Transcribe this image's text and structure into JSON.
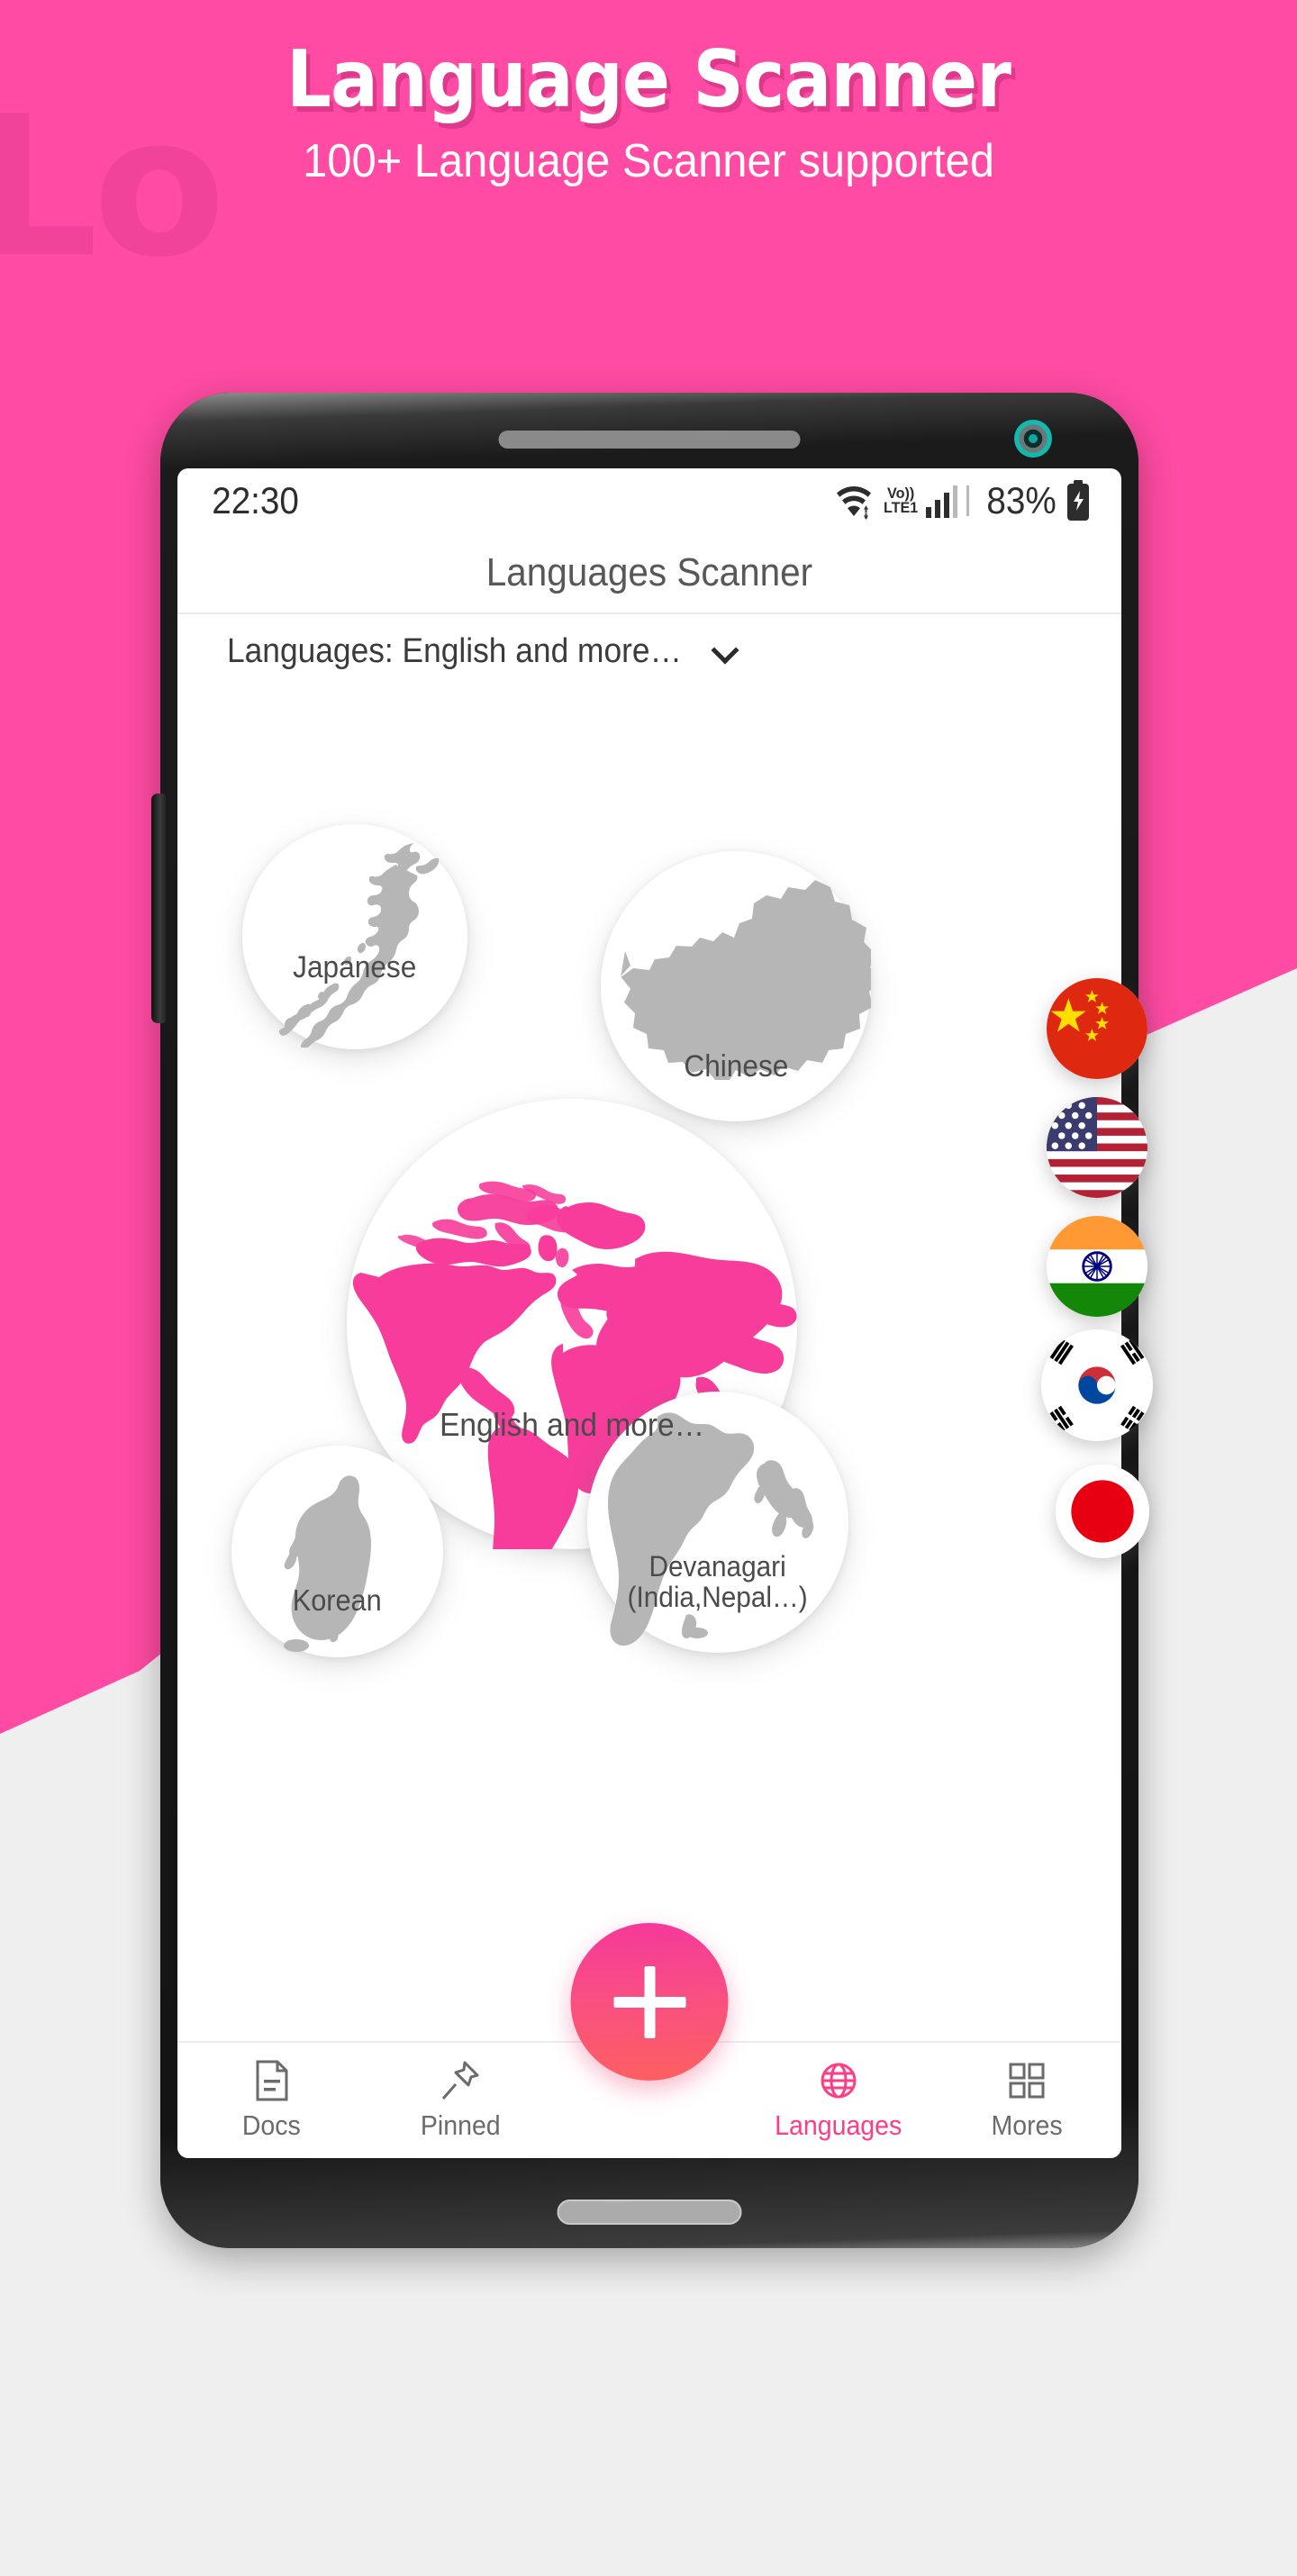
{
  "promo": {
    "headline": "Language Scanner",
    "subheadline": "100+ Language Scanner supported",
    "watermark": "Lo",
    "background_color": "#FF4BA3",
    "accent_color": "#FF3D86"
  },
  "status_bar": {
    "time": "22:30",
    "wifi_icon": "wifi-icon",
    "volte_top": "Vo))",
    "volte_bottom": "LTE1",
    "signal_icon": "signal-bars-icon",
    "battery_percent": "83%",
    "battery_icon": "battery-charging-icon"
  },
  "app_bar": {
    "title": "Languages Scanner"
  },
  "language_selector": {
    "label": "Languages: English and more…",
    "chevron_icon": "chevron-down-icon"
  },
  "bubbles": [
    {
      "id": "japanese",
      "label": "Japanese",
      "map_icon": "japan-map-icon"
    },
    {
      "id": "chinese",
      "label": "Chinese",
      "map_icon": "china-map-icon"
    },
    {
      "id": "english",
      "label": "English and more…",
      "map_icon": "world-map-icon"
    },
    {
      "id": "korean",
      "label": "Korean",
      "map_icon": "south-korea-map-icon"
    },
    {
      "id": "devanagari",
      "label": "Devanagari\n(India,Nepal…)",
      "label_line1": "Devanagari",
      "label_line2": "(India,Nepal…)",
      "map_icon": "india-map-icon"
    }
  ],
  "flags": [
    {
      "id": "cn",
      "name": "china-flag-icon"
    },
    {
      "id": "us",
      "name": "usa-flag-icon"
    },
    {
      "id": "in",
      "name": "india-flag-icon"
    },
    {
      "id": "kr",
      "name": "south-korea-flag-icon"
    },
    {
      "id": "jp",
      "name": "japan-flag-icon"
    }
  ],
  "fab": {
    "icon": "plus-icon",
    "gradient_from": "#F5389B",
    "gradient_to": "#FC6060"
  },
  "bottom_nav": {
    "items": [
      {
        "label": "Docs",
        "icon": "document-icon",
        "active": false
      },
      {
        "label": "Pinned",
        "icon": "pin-icon",
        "active": false
      },
      {
        "label": "Languages",
        "icon": "globe-icon",
        "active": true
      },
      {
        "label": "Mores",
        "icon": "grid-icon",
        "active": false
      }
    ]
  }
}
